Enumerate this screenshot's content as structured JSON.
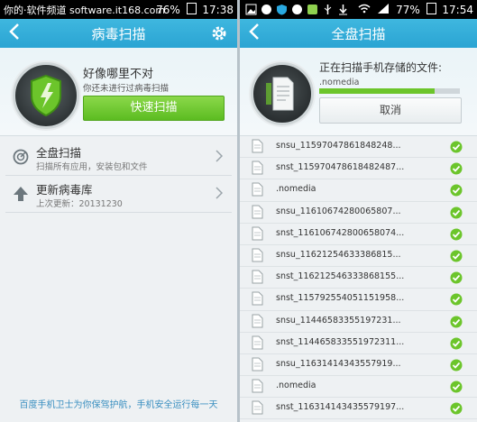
{
  "left": {
    "status": {
      "watermark": "你的·软件频道 software.it168.com",
      "battery": "76%",
      "time": "17:38"
    },
    "appbar": {
      "title": "病毒扫描"
    },
    "hero": {
      "title": "好像哪里不对",
      "subtitle": "你还未进行过病毒扫描",
      "button": "快速扫描"
    },
    "menu": [
      {
        "title": "全盘扫描",
        "subtitle": "扫描所有应用，安装包和文件",
        "icon": "radar-icon"
      },
      {
        "title": "更新病毒库",
        "subtitle": "上次更新：20131230",
        "icon": "upload-arrow-icon"
      }
    ],
    "footer": "百度手机卫士为你保驾护航，手机安全运行每一天"
  },
  "right": {
    "status": {
      "battery": "77%",
      "time": "17:54"
    },
    "appbar": {
      "title": "全盘扫描"
    },
    "scan": {
      "title": "正在扫描手机存储的文件:",
      "file": ".nomedia",
      "progress_pct": 82,
      "cancel": "取消"
    },
    "files": [
      "snsu_115970478618482​48...",
      "snst_11597047861848248​7...",
      ".nomedia",
      "snsu_116106742800658​07...",
      "snst_11610674280065807​4...",
      "snsu_116212546333868​15...",
      "snst_11621254633386815​5...",
      "snst_115792554051151​958...",
      "snsu_114465833551972​31...",
      "snst_11446583355197231​1...",
      "snsu_116314143435579​19...",
      ".nomedia",
      "snst_116314143435579​197..."
    ]
  },
  "colors": {
    "accent": "#2aa4d3",
    "green": "#5cbc21",
    "link": "#3a8fc0"
  }
}
